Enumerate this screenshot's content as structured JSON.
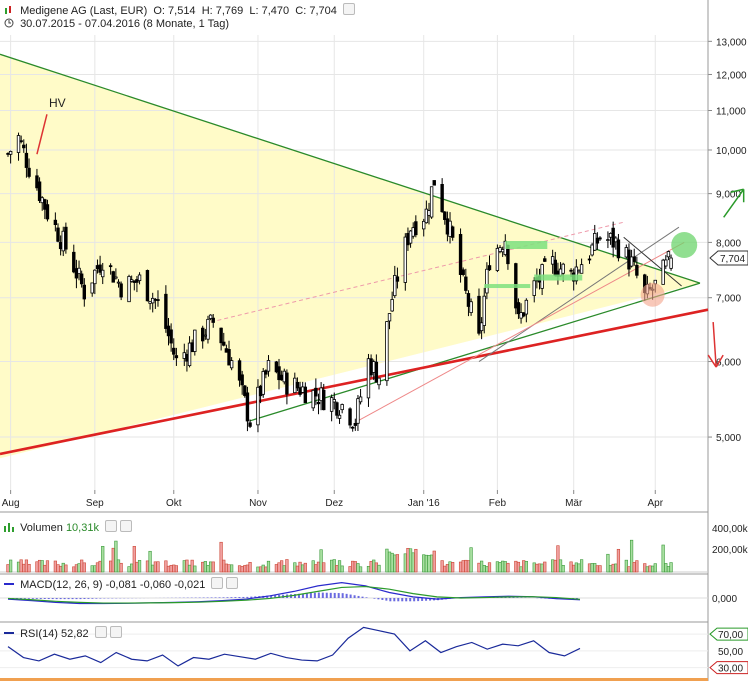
{
  "header": {
    "title": "Medigene AG (Last, EUR)",
    "open": "O: 7,514",
    "high": "H: 7,769",
    "low": "L: 7,470",
    "close": "C: 7,704",
    "range": "30.07.2015 - 07.04.2016 (8 Monate, 1 Tag)"
  },
  "annotation_hv": "HV",
  "colors": {
    "bull": "#2e9e2e",
    "bear": "#cc2222",
    "triangle": "#fffbc8",
    "support": "#d22",
    "wedge": "#3a8a2a",
    "macd": "#2a2acc",
    "signal": "#2a9a2a",
    "rsi": "#1a2a9a"
  },
  "chart_data": [
    {
      "type": "candlestick",
      "title": "Medigene AG (Last, EUR)",
      "x_tick_labels": [
        "Aug",
        "Sep",
        "Okt",
        "Nov",
        "Dez",
        "Jan '16",
        "Feb",
        "Mär",
        "Apr"
      ],
      "y_tick_labels": [
        "13,000",
        "12,000",
        "11,000",
        "10,000",
        "9,000",
        "8,000",
        "7,000",
        "6,000",
        "5,000"
      ],
      "y_ticks": [
        13,
        12,
        11,
        10,
        9,
        8,
        7,
        6,
        5
      ],
      "ylim": [
        4.4,
        13.2
      ],
      "y_scale": "log",
      "last_price_label": "7,704",
      "last_price": 7.704,
      "close_path": [
        {
          "date": "2015-07-30",
          "close": 9.9
        },
        {
          "date": "2015-08-03",
          "close": 10.3
        },
        {
          "date": "2015-08-07",
          "close": 9.6
        },
        {
          "date": "2015-08-14",
          "close": 8.6
        },
        {
          "date": "2015-08-21",
          "close": 7.9
        },
        {
          "date": "2015-08-28",
          "close": 7.1
        },
        {
          "date": "2015-09-04",
          "close": 7.7
        },
        {
          "date": "2015-09-11",
          "close": 7.2
        },
        {
          "date": "2015-09-18",
          "close": 7.3
        },
        {
          "date": "2015-09-25",
          "close": 6.9
        },
        {
          "date": "2015-10-02",
          "close": 6.0
        },
        {
          "date": "2015-10-09",
          "close": 6.3
        },
        {
          "date": "2015-10-16",
          "close": 6.6
        },
        {
          "date": "2015-10-23",
          "close": 6.0
        },
        {
          "date": "2015-10-30",
          "close": 5.2
        },
        {
          "date": "2015-11-06",
          "close": 5.9
        },
        {
          "date": "2015-11-13",
          "close": 5.7
        },
        {
          "date": "2015-11-20",
          "close": 5.6
        },
        {
          "date": "2015-11-27",
          "close": 5.5
        },
        {
          "date": "2015-12-04",
          "close": 5.4
        },
        {
          "date": "2015-12-09",
          "close": 5.2
        },
        {
          "date": "2015-12-14",
          "close": 6.0
        },
        {
          "date": "2015-12-18",
          "close": 5.8
        },
        {
          "date": "2015-12-23",
          "close": 7.0
        },
        {
          "date": "2015-12-30",
          "close": 8.3
        },
        {
          "date": "2016-01-05",
          "close": 8.6
        },
        {
          "date": "2016-01-08",
          "close": 9.3
        },
        {
          "date": "2016-01-13",
          "close": 8.4
        },
        {
          "date": "2016-01-19",
          "close": 7.2
        },
        {
          "date": "2016-01-25",
          "close": 6.3
        },
        {
          "date": "2016-01-29",
          "close": 7.7
        },
        {
          "date": "2016-02-04",
          "close": 8.1
        },
        {
          "date": "2016-02-09",
          "close": 6.6
        },
        {
          "date": "2016-02-15",
          "close": 7.2
        },
        {
          "date": "2016-02-22",
          "close": 7.6
        },
        {
          "date": "2016-02-29",
          "close": 7.4
        },
        {
          "date": "2016-03-07",
          "close": 7.8
        },
        {
          "date": "2016-03-11",
          "close": 8.1
        },
        {
          "date": "2016-03-17",
          "close": 8.0
        },
        {
          "date": "2016-03-23",
          "close": 7.6
        },
        {
          "date": "2016-03-28",
          "close": 7.0
        },
        {
          "date": "2016-04-01",
          "close": 7.2
        },
        {
          "date": "2016-04-07",
          "close": 7.704
        }
      ],
      "drawings": {
        "triangle_upper_line": [
          {
            "date": "2015-07-30",
            "price": 12.6
          },
          {
            "date": "2016-04-18",
            "price": 7.25
          }
        ],
        "triangle_lower_line": [
          {
            "date": "2015-07-30",
            "price": 4.75
          },
          {
            "date": "2016-04-18",
            "price": 6.8
          }
        ],
        "support_line": [
          {
            "date": "2015-07-30",
            "price": 4.8
          },
          {
            "date": "2016-04-18",
            "price": 6.8
          }
        ],
        "signals": [
          "up-arrow",
          "down-arrow",
          "breakout-circle",
          "pullback-circle"
        ]
      }
    },
    {
      "type": "bar",
      "title": "Volumen",
      "label": "Volumen",
      "value_label": "10,31k",
      "y_tick_labels": [
        "400,00k",
        "200,00k"
      ],
      "ylim": [
        0,
        480000
      ]
    },
    {
      "type": "line",
      "title": "MACD(12, 26, 9)",
      "label": "MACD(12, 26, 9)",
      "values_label": [
        "-0,081",
        "-0,060",
        "-0,021"
      ],
      "y_tick_labels": [
        "0,000"
      ],
      "macd": [
        -0.05,
        -0.12,
        -0.2,
        -0.25,
        -0.25,
        -0.24,
        -0.22,
        -0.2,
        -0.17,
        -0.12,
        -0.05,
        0.1,
        0.3,
        0.55,
        0.7,
        0.55,
        0.25,
        0.05,
        -0.05,
        0.02,
        0.05,
        0.08,
        0.06,
        -0.03,
        -0.081
      ],
      "signal": [
        -0.02,
        -0.08,
        -0.15,
        -0.2,
        -0.23,
        -0.23,
        -0.22,
        -0.21,
        -0.19,
        -0.15,
        -0.1,
        -0.02,
        0.12,
        0.3,
        0.48,
        0.52,
        0.4,
        0.2,
        0.05,
        0.0,
        0.02,
        0.05,
        0.06,
        0.02,
        -0.06
      ]
    },
    {
      "type": "line",
      "title": "RSI(14)",
      "label": "RSI(14)",
      "value_label": "52,82",
      "y_tick_labels": [
        "70,00",
        "50,00",
        "30,00"
      ],
      "ylim": [
        20,
        82
      ],
      "values": [
        55,
        42,
        38,
        46,
        40,
        44,
        36,
        48,
        40,
        38,
        45,
        32,
        42,
        40,
        46,
        43,
        40,
        47,
        42,
        39,
        38,
        45,
        65,
        78,
        74,
        70,
        50,
        62,
        48,
        55,
        60,
        52,
        58,
        56,
        62,
        48,
        44,
        52.82
      ]
    }
  ]
}
